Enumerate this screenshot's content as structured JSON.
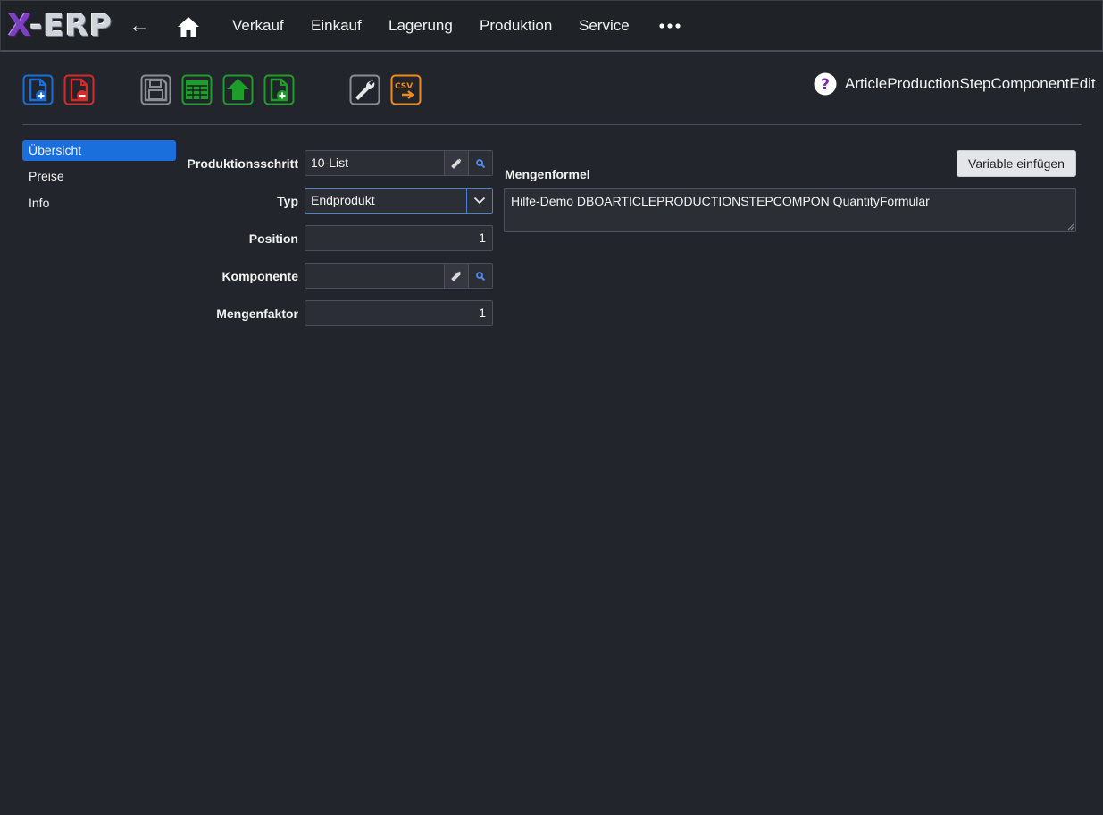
{
  "app": {
    "logo_text": "X-ERP",
    "back_label": "←"
  },
  "nav": {
    "items": [
      "Verkauf",
      "Einkauf",
      "Lagerung",
      "Produktion",
      "Service"
    ]
  },
  "toolbar": {
    "icons": [
      "new-document-icon",
      "delete-document-icon",
      "save-icon",
      "table-view-icon",
      "move-up-icon",
      "copy-document-icon",
      "wrench-icon",
      "csv-export-icon"
    ],
    "csv_text": "CSV",
    "form_name": "ArticleProductionStepComponentEdit",
    "colors": {
      "blue": "#1b6fdc",
      "red": "#d42b2b",
      "gray": "#8a8d93",
      "green": "#1f9d2a",
      "orange": "#f08a1b"
    }
  },
  "sidebar": {
    "items": [
      {
        "label": "Übersicht",
        "active": true
      },
      {
        "label": "Preise",
        "active": false
      },
      {
        "label": "Info",
        "active": false
      }
    ]
  },
  "form": {
    "produktionsschritt": {
      "label": "Produktionsschritt",
      "value": "10-List"
    },
    "typ": {
      "label": "Typ",
      "value": "Endprodukt"
    },
    "position": {
      "label": "Position",
      "value": "1"
    },
    "komponente": {
      "label": "Komponente",
      "value": ""
    },
    "mengenfaktor": {
      "label": "Mengenfaktor",
      "value": "1"
    }
  },
  "formula": {
    "label": "Mengenformel",
    "button_label": "Variable einfügen",
    "value": "Hilfe-Demo DBOARTICLEPRODUCTIONSTEPCOMPON QuantityFormular"
  }
}
